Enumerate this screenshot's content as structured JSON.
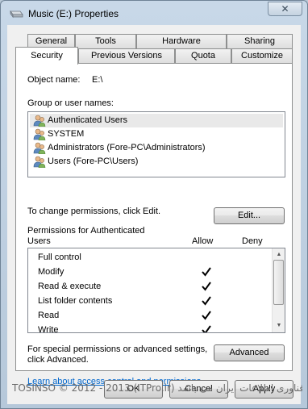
{
  "window": {
    "title": "Music (E:) Properties",
    "close_glyph": "✕"
  },
  "tabs_row1": [
    "General",
    "Tools",
    "Hardware",
    "Sharing"
  ],
  "tabs_row2": [
    "Security",
    "Previous Versions",
    "Quota",
    "Customize"
  ],
  "active_tab": "Security",
  "security": {
    "object_name_label": "Object name:",
    "object_name_value": "E:\\",
    "groups_label": "Group or user names:",
    "groups": [
      "Authenticated Users",
      "SYSTEM",
      "Administrators (Fore-PC\\Administrators)",
      "Users (Fore-PC\\Users)"
    ],
    "selected_group_index": 0,
    "change_permissions_text": "To change permissions, click Edit.",
    "edit_button": "Edit...",
    "permissions_for_line1": "Permissions for Authenticated",
    "permissions_for_line2": "Users",
    "allow_header": "Allow",
    "deny_header": "Deny",
    "permissions": [
      {
        "name": "Full control",
        "allow": false,
        "deny": false
      },
      {
        "name": "Modify",
        "allow": true,
        "deny": false
      },
      {
        "name": "Read & execute",
        "allow": true,
        "deny": false
      },
      {
        "name": "List folder contents",
        "allow": true,
        "deny": false
      },
      {
        "name": "Read",
        "allow": true,
        "deny": false
      },
      {
        "name": "Write",
        "allow": true,
        "deny": false
      }
    ],
    "special_text_line1": "For special permissions or advanced settings,",
    "special_text_line2": "click Advanced.",
    "advanced_button": "Advanced",
    "learn_link": "Learn about access control and permissions"
  },
  "footer": {
    "ok_button": "OK",
    "cancel_button": "Cancel",
    "apply_button": "Apply"
  },
  "watermark": "TOSINSO © 2012 - 2013 (ITPro.ir) کلیه حقوق مادی و معنوی این اثر متعلق به انجمن تخصصی فناوری اطلاعات ایران می باشد",
  "colors": {
    "link": "#0066cc",
    "selected_row": "#e9e9e9",
    "frame": "#b6c8da"
  }
}
